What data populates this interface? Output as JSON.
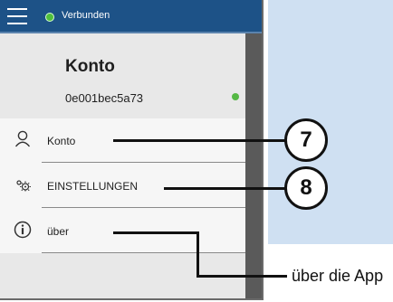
{
  "app": {
    "status_text": "Verbunden",
    "status_color": "#4fbf3c",
    "header_color": "#1d5287"
  },
  "account": {
    "title": "Konto",
    "device_id": "0e001bec5a73",
    "status_color": "#55b845"
  },
  "menu": {
    "items": [
      {
        "label": "Konto",
        "icon": "user-icon"
      },
      {
        "label": "EINSTELLUNGEN",
        "icon": "settings-icon"
      },
      {
        "label": "über",
        "icon": "info-icon"
      }
    ]
  },
  "callouts": {
    "item_7": "7",
    "item_8": "8",
    "about_text": "über die App"
  }
}
